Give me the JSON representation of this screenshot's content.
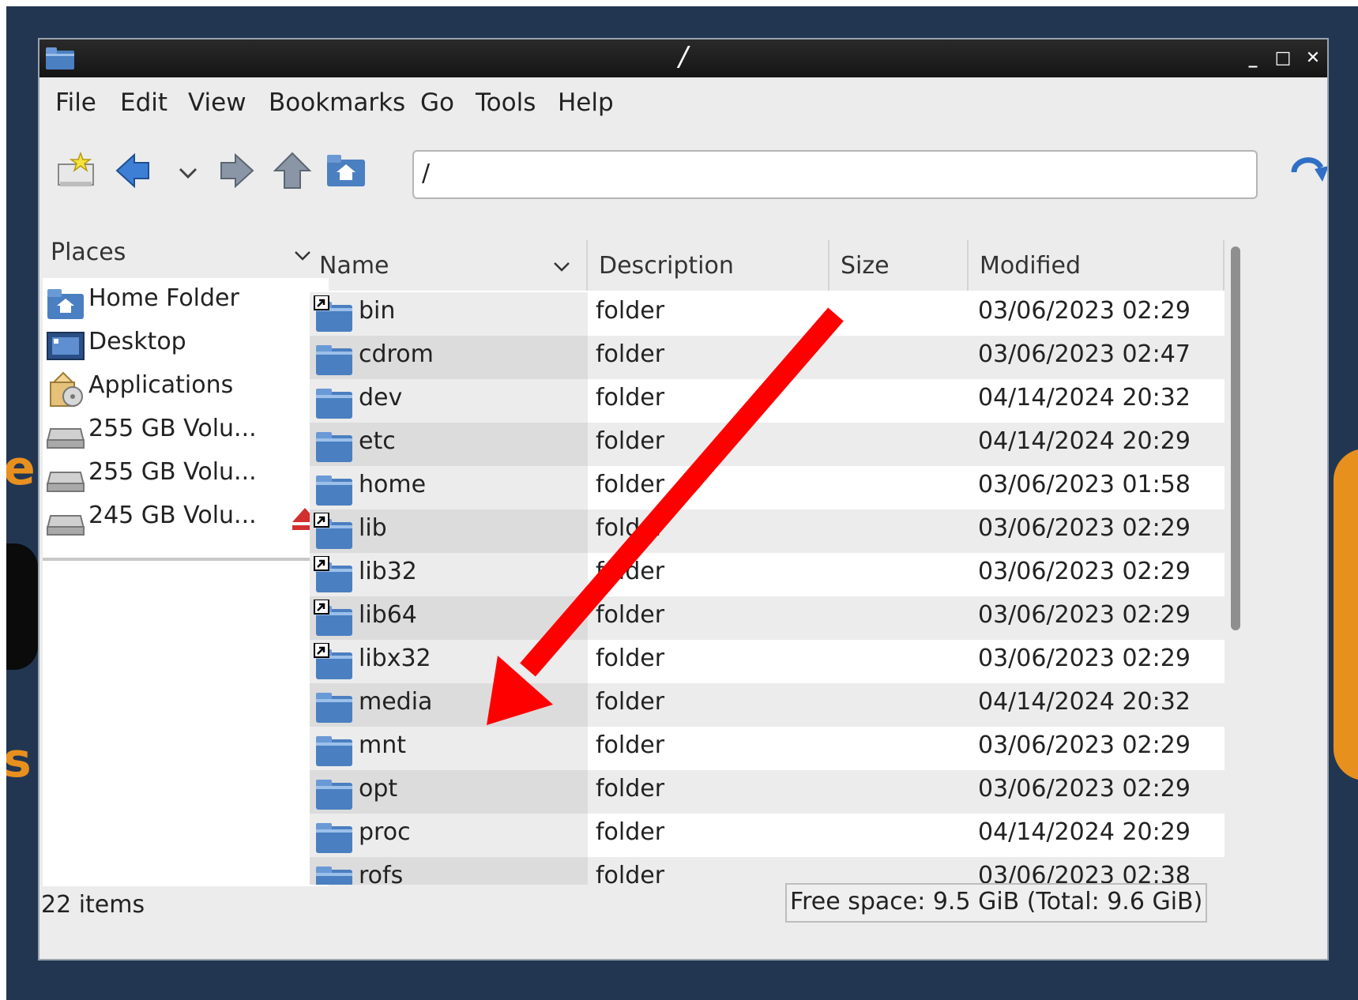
{
  "window": {
    "title": "/"
  },
  "menu": [
    "File",
    "Edit",
    "View",
    "Bookmarks",
    "Go",
    "Tools",
    "Help"
  ],
  "toolbar": {
    "icons": [
      "new-window-icon",
      "back-arrow-icon",
      "history-dropdown-icon",
      "forward-arrow-icon",
      "up-arrow-icon",
      "home-folder-icon",
      "refresh-icon"
    ],
    "location": "/"
  },
  "places": {
    "header": "Places",
    "items": [
      {
        "label": "Home Folder",
        "icon": "home-folder-icon"
      },
      {
        "label": "Desktop",
        "icon": "desktop-icon"
      },
      {
        "label": "Applications",
        "icon": "applications-icon"
      },
      {
        "label": "255 GB Volu...",
        "icon": "drive-icon"
      },
      {
        "label": "255 GB Volu...",
        "icon": "drive-icon"
      },
      {
        "label": "245 GB Volu...",
        "icon": "drive-icon",
        "eject": true
      }
    ]
  },
  "columns": {
    "name": "Name",
    "description": "Description",
    "size": "Size",
    "modified": "Modified"
  },
  "files": [
    {
      "name": "bin",
      "description": "folder",
      "size": "",
      "modified": "03/06/2023 02:29",
      "link": true
    },
    {
      "name": "cdrom",
      "description": "folder",
      "size": "",
      "modified": "03/06/2023 02:47",
      "link": false
    },
    {
      "name": "dev",
      "description": "folder",
      "size": "",
      "modified": "04/14/2024 20:32",
      "link": false
    },
    {
      "name": "etc",
      "description": "folder",
      "size": "",
      "modified": "04/14/2024 20:29",
      "link": false
    },
    {
      "name": "home",
      "description": "folder",
      "size": "",
      "modified": "03/06/2023 01:58",
      "link": false
    },
    {
      "name": "lib",
      "description": "folder",
      "size": "",
      "modified": "03/06/2023 02:29",
      "link": true
    },
    {
      "name": "lib32",
      "description": "folder",
      "size": "",
      "modified": "03/06/2023 02:29",
      "link": true
    },
    {
      "name": "lib64",
      "description": "folder",
      "size": "",
      "modified": "03/06/2023 02:29",
      "link": true
    },
    {
      "name": "libx32",
      "description": "folder",
      "size": "",
      "modified": "03/06/2023 02:29",
      "link": true
    },
    {
      "name": "media",
      "description": "folder",
      "size": "",
      "modified": "04/14/2024 20:32",
      "link": false
    },
    {
      "name": "mnt",
      "description": "folder",
      "size": "",
      "modified": "03/06/2023 02:29",
      "link": false
    },
    {
      "name": "opt",
      "description": "folder",
      "size": "",
      "modified": "03/06/2023 02:29",
      "link": false
    },
    {
      "name": "proc",
      "description": "folder",
      "size": "",
      "modified": "04/14/2024 20:29",
      "link": false
    },
    {
      "name": "rofs",
      "description": "folder",
      "size": "",
      "modified": "03/06/2023 02:38",
      "link": false
    }
  ],
  "status": {
    "items": "22 items",
    "free_space": "Free space: 9.5 GiB (Total: 9.6 GiB)"
  },
  "colors": {
    "desktop": "#223652",
    "folder_blue": "#4a7fc1",
    "annotation_arrow": "#ff0000",
    "accent_orange": "#e8901e"
  }
}
